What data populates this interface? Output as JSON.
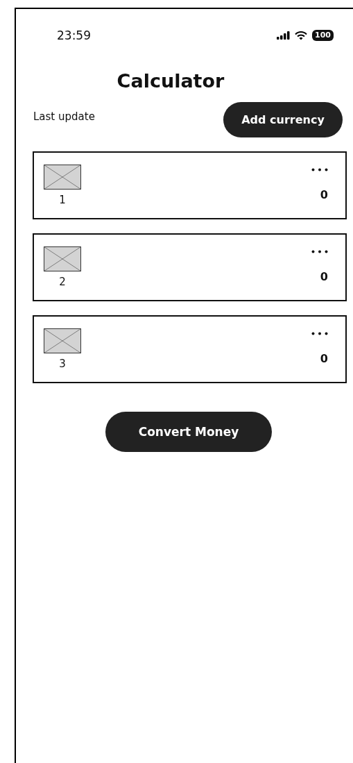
{
  "status_bar": {
    "time": "23:59",
    "battery": "100"
  },
  "title": "Calculator",
  "last_update": "Last update",
  "add_button": "Add currency",
  "currencies": [
    {
      "label": "1",
      "amount": "0"
    },
    {
      "label": "2",
      "amount": "0"
    },
    {
      "label": "3",
      "amount": "0"
    }
  ],
  "convert_button": "Convert Money"
}
